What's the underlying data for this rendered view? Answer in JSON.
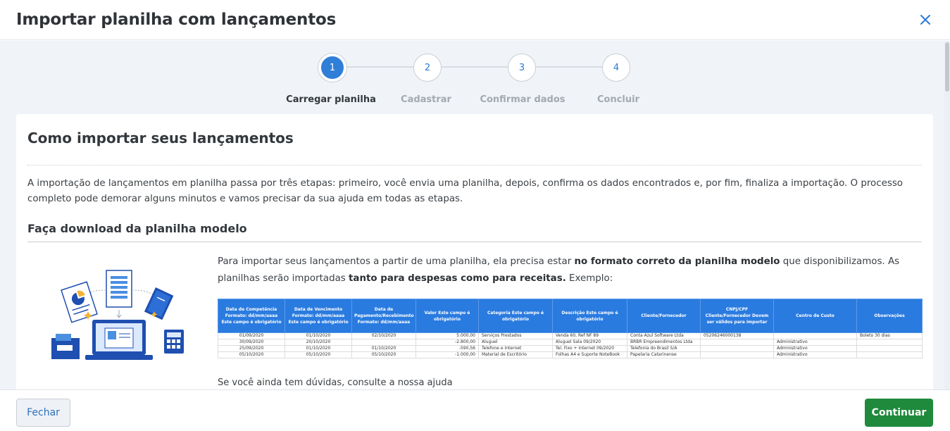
{
  "modal": {
    "title": "Importar planilha com lançamentos",
    "close_icon": "close-icon"
  },
  "stepper": {
    "steps": [
      {
        "number": "1",
        "label": "Carregar planilha",
        "active": true
      },
      {
        "number": "2",
        "label": "Cadastrar",
        "active": false
      },
      {
        "number": "3",
        "label": "Confirmar dados",
        "active": false
      },
      {
        "number": "4",
        "label": "Concluir",
        "active": false
      }
    ]
  },
  "content": {
    "heading": "Como importar seus lançamentos",
    "intro": "A importação de lançamentos em planilha passa por três etapas: primeiro, você envia uma planilha, depois, confirma os dados encontrados e, por fim, finaliza a importação. O processo completo pode demorar alguns minutos e vamos precisar da sua ajuda em todas as etapas.",
    "download_heading": "Faça download da planilha modelo",
    "desc_part1": "Para importar seus lançamentos a partir de uma planilha, ela precisa estar ",
    "desc_bold1": "no formato correto da planilha modelo",
    "desc_part2": " que disponibilizamos. As planilhas serão importadas ",
    "desc_bold2": "tanto para despesas como para receitas.",
    "desc_part3": " Exemplo:",
    "cut_text": "Se você ainda tem dúvidas, consulte a nossa ajuda"
  },
  "sample_table": {
    "headers": [
      "Data de Competência Formato: dd/mm/aaaa Este campo é obrigatório",
      "Data de Vencimento Formato: dd/mm/aaaa Este campo é obrigatório",
      "Data de Pagamento/Recebimento Formato: dd/mm/aaaa",
      "Valor Este campo é obrigatório",
      "Categoria Este campo é obrigatório",
      "Descrição Este campo é obrigatório",
      "Cliente/Fornecedor",
      "CNPJ/CPF Cliente/Fornecedor Devem ser válidos para importar",
      "Centro de Custo",
      "Observações"
    ],
    "rows": [
      [
        "01/09/2020",
        "01/10/2020",
        "02/10/2020",
        "5.000,00",
        "Serviços Prestados",
        "Venda 60, Ref NF 89",
        "Conta Azul Software Ltda",
        "05206246000138",
        "",
        "Boleto 30 dias"
      ],
      [
        "30/09/2020",
        "20/10/2020",
        "",
        "-2.800,00",
        "Aluguel",
        "Aluguel Sala 09/2020",
        "BRBR Empreendimentos Ltda",
        "",
        "Administrativo",
        ""
      ],
      [
        "25/09/2020",
        "01/10/2020",
        "01/10/2020",
        "-590,56",
        "Telefone e Internet",
        "Tel. Fixo + Internet 09/2020",
        "Telefonia do Brasil S/A",
        "",
        "Administrativo",
        ""
      ],
      [
        "05/10/2020",
        "05/10/2020",
        "05/10/2020",
        "-1.000,00",
        "Material de Escritório",
        "Folhas A4 e Suporte NoteBook",
        "Papelaria Catarinense",
        "",
        "Administrativo",
        ""
      ]
    ]
  },
  "footer": {
    "close_label": "Fechar",
    "continue_label": "Continuar"
  },
  "colors": {
    "primary_blue": "#2f7fd9",
    "success_green": "#1f8a3c",
    "table_header": "#2a7be0"
  }
}
